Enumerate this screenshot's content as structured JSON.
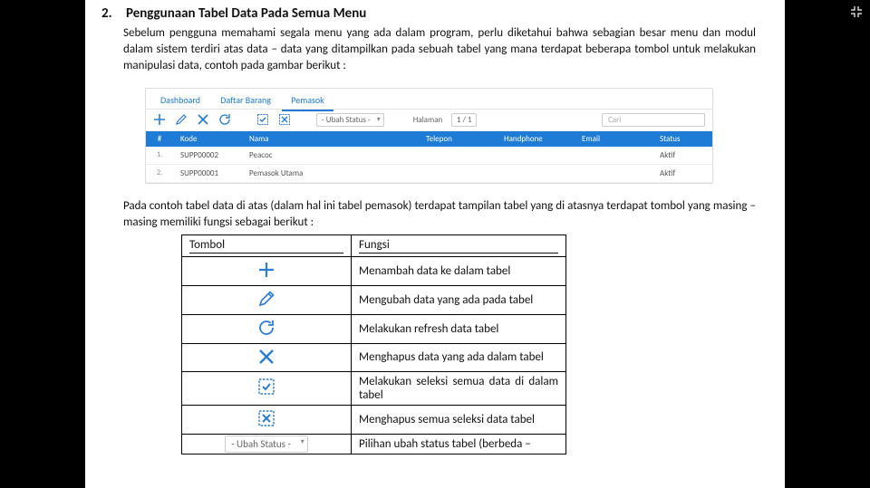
{
  "section_number": "2.",
  "title": "Penggunaan Tabel Data Pada Semua Menu",
  "paragraph1": "Sebelum pengguna memahami segala menu yang ada dalam program, perlu diketahui bahwa sebagian besar menu dan modul dalam sistem terdiri atas data – data yang ditampilkan pada sebuah tabel yang mana terdapat beberapa tombol untuk melakukan manipulasi data, contoh pada gambar berikut :",
  "screenshot": {
    "tabs": [
      "Dashboard",
      "Daftar Barang",
      "Pemasok"
    ],
    "active_tab": 2,
    "status_select": "- Ubah Status -",
    "page_label": "Halaman",
    "page_value": "1 / 1",
    "search_placeholder": "Cari",
    "columns": [
      "#",
      "Kode",
      "Nama",
      "Telepon",
      "Handphone",
      "Email",
      "Status"
    ],
    "rows": [
      {
        "n": "1.",
        "kode": "SUPP00002",
        "nama": "Peacoc",
        "status": "Aktif"
      },
      {
        "n": "2.",
        "kode": "SUPP00001",
        "nama": "Pemasok Utama",
        "status": "Aktif"
      }
    ]
  },
  "paragraph2": "Pada contoh tabel data di atas (dalam hal ini tabel pemasok) terdapat tampilan tabel yang di atasnya terdapat tombol yang masing – masing memiliki fungsi sebagai berikut :",
  "func_header": {
    "c1": "Tombol",
    "c2": "Fungsi"
  },
  "func_rows": [
    {
      "icon": "plus",
      "desc": "Menambah data ke dalam tabel"
    },
    {
      "icon": "edit",
      "desc": "Mengubah data yang ada pada tabel"
    },
    {
      "icon": "refresh",
      "desc": "Melakukan refresh data tabel"
    },
    {
      "icon": "close",
      "desc": "Menghapus data yang ada dalam tabel"
    },
    {
      "icon": "select-all",
      "desc": "Melakukan seleksi semua data di dalam tabel"
    },
    {
      "icon": "deselect-all",
      "desc": "Menghapus semua seleksi data tabel"
    },
    {
      "icon": "status",
      "desc": "Pilihan ubah status tabel (berbeda –"
    }
  ],
  "status_btn_label": "- Ubah Status -"
}
